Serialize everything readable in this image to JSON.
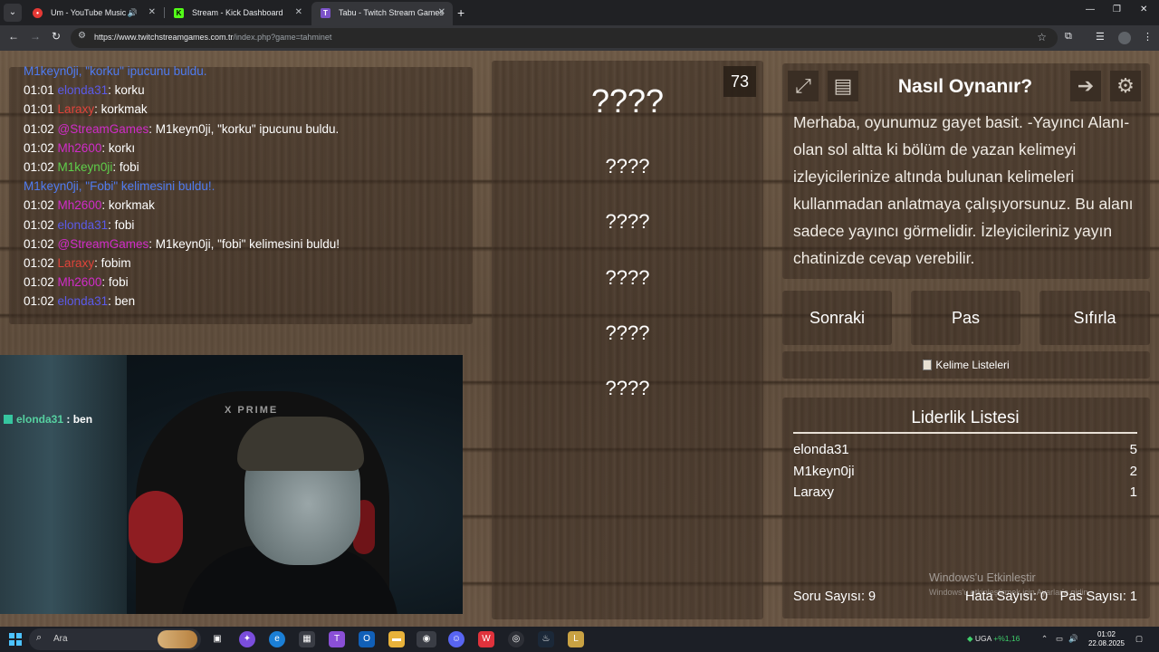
{
  "browser": {
    "tabs": [
      {
        "title": "Um - YouTube Music",
        "active": false
      },
      {
        "title": "Stream - Kick Dashboard",
        "active": false
      },
      {
        "title": "Tabu - Twitch Stream Games",
        "active": true
      }
    ],
    "url_host": "https://www.twitchstreamgames.com.tr",
    "url_path": "/index.php?game=tahminet"
  },
  "chat": {
    "lines": [
      {
        "time": "",
        "user": "M1keyn0ji, ",
        "user_color": "sys",
        "sep": "",
        "text": "\"korku\" ipucunu buldu."
      },
      {
        "time": "01:01 ",
        "user": "elonda31",
        "user_color": "blue",
        "sep": ": ",
        "text": "korku"
      },
      {
        "time": "01:01 ",
        "user": "Laraxy",
        "user_color": "red",
        "sep": ": ",
        "text": "korkmak"
      },
      {
        "time": "01:02 ",
        "user": "@StreamGames",
        "user_color": "magenta",
        "sep": ": ",
        "text": "M1keyn0ji, \"korku\" ipucunu buldu."
      },
      {
        "time": "01:02 ",
        "user": "Mh2600",
        "user_color": "magenta",
        "sep": ": ",
        "text": "korkı"
      },
      {
        "time": "01:02 ",
        "user": "M1keyn0ji",
        "user_color": "green",
        "sep": ": ",
        "text": "fobi"
      },
      {
        "time": "",
        "user": "M1keyn0ji, ",
        "user_color": "sys",
        "sep": "",
        "text": "\"Fobi\" kelimesini buldu!."
      },
      {
        "time": "01:02 ",
        "user": "Mh2600",
        "user_color": "magenta",
        "sep": ": ",
        "text": "korkmak"
      },
      {
        "time": "01:02 ",
        "user": "elonda31",
        "user_color": "blue",
        "sep": ": ",
        "text": "fobi"
      },
      {
        "time": "01:02 ",
        "user": "@StreamGames",
        "user_color": "magenta",
        "sep": ": ",
        "text": "M1keyn0ji, \"fobi\" kelimesini buldu!"
      },
      {
        "time": "01:02 ",
        "user": "Laraxy",
        "user_color": "red",
        "sep": ": ",
        "text": "fobim"
      },
      {
        "time": "01:02 ",
        "user": "Mh2600",
        "user_color": "magenta",
        "sep": ": ",
        "text": "fobi"
      },
      {
        "time": "01:02 ",
        "user": "elonda31",
        "user_color": "blue",
        "sep": ": ",
        "text": "ben"
      }
    ]
  },
  "webcam": {
    "brand": "X PRIME",
    "overlay_user": "elonda31",
    "overlay_sep": " : ",
    "overlay_msg": "ben"
  },
  "game": {
    "counter": "73",
    "main_word": "????",
    "hint_words": [
      "????",
      "????",
      "????",
      "????",
      "????"
    ]
  },
  "info": {
    "title": "Nasıl Oynanır?",
    "text": "Merhaba, oyunumuz gayet basit. -Yayıncı Alanı-olan sol altta ki bölüm de yazan kelimeyi izleyicilerinize altında bulunan kelimeleri kullanmadan anlatmaya çalışıyorsunuz. Bu alanı sadece yayıncı görmelidir. İzleyicileriniz yayın chatinizde cevap verebilir."
  },
  "controls": {
    "next": "Sonraki",
    "pass": "Pas",
    "reset": "Sıfırla",
    "word_lists": "Kelime Listeleri"
  },
  "leaderboard": {
    "title": "Liderlik Listesi",
    "rows": [
      {
        "name": "elonda31",
        "score": "5"
      },
      {
        "name": "M1keyn0ji",
        "score": "2"
      },
      {
        "name": "Laraxy",
        "score": "1"
      }
    ],
    "stats": {
      "questions": "Soru Sayısı: 9",
      "errors": "Hata Sayısı: 0",
      "passes": "Pas Sayısı: 1"
    }
  },
  "watermark": {
    "line1": "Windows'u Etkinleştir",
    "line2": "Windows'u etkinleştirmek için Ayarlar'a gidin."
  },
  "taskbar": {
    "search_placeholder": "Ara",
    "currency": "UGA",
    "change": "+%1,16",
    "time": "01:02",
    "date": "22.08.2025"
  },
  "colors": {
    "sys": "#4f7bf0",
    "blue": "#5b5ae8",
    "red": "#e0433a",
    "magenta": "#d02cc8",
    "green": "#5ee08c"
  }
}
